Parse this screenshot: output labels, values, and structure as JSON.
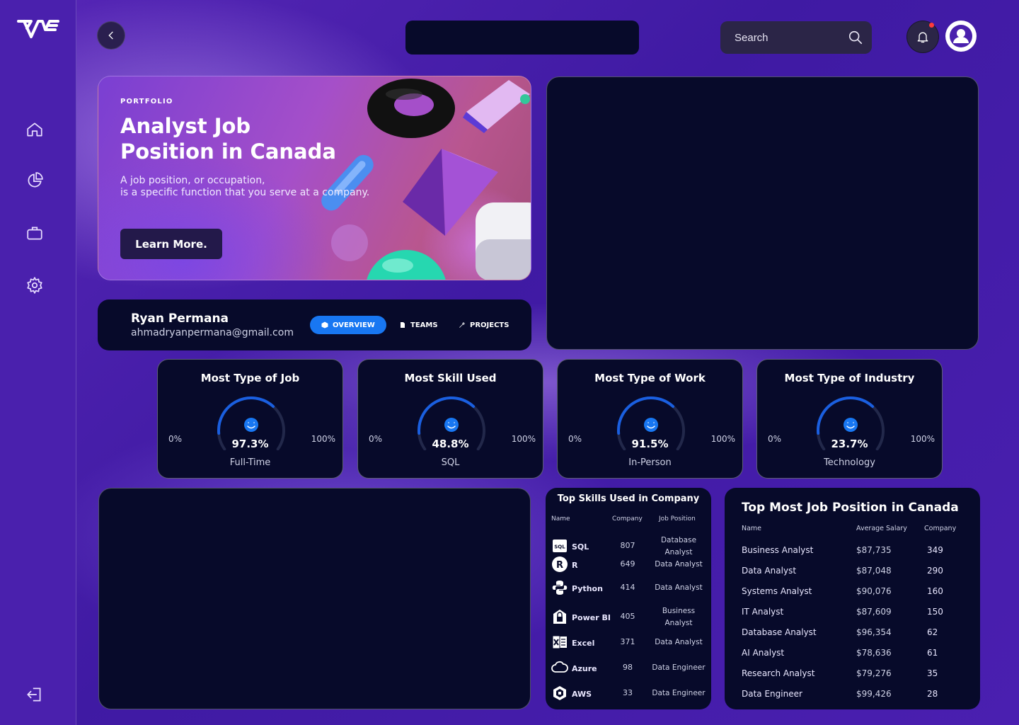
{
  "search": {
    "placeholder": "Search"
  },
  "hero": {
    "tag": "PORTFOLIO",
    "title": "Analyst Job Position in Canada",
    "desc_line1": "A job position, or occupation,",
    "desc_line2": "is a specific function that you serve at a company.",
    "button": "Learn More."
  },
  "profile": {
    "name": "Ryan Permana",
    "email": "ahmadryanpermana@gmail.com",
    "tabs": [
      {
        "label": "OVERVIEW",
        "icon": "cube-icon",
        "active": true
      },
      {
        "label": "TEAMS",
        "icon": "document-icon",
        "active": false
      },
      {
        "label": "PROJECTS",
        "icon": "wrench-icon",
        "active": false
      }
    ]
  },
  "gauges": [
    {
      "title": "Most Type of Job",
      "min": "0%",
      "max": "100%",
      "value_text": "97.3%",
      "value": 97.3,
      "label": "Full-Time"
    },
    {
      "title": "Most Skill Used",
      "min": "0%",
      "max": "100%",
      "value_text": "48.8%",
      "value": 48.8,
      "label": "SQL"
    },
    {
      "title": "Most Type of Work",
      "min": "0%",
      "max": "100%",
      "value_text": "91.5%",
      "value": 91.5,
      "label": "In-Person"
    },
    {
      "title": "Most Type of Industry",
      "min": "0%",
      "max": "100%",
      "value_text": "23.7%",
      "value": 23.7,
      "label": "Technology"
    }
  ],
  "skills": {
    "title": "Top Skills Used in Company",
    "headers": [
      "Name",
      "Company",
      "Job Position"
    ],
    "rows": [
      {
        "name": "SQL",
        "icon": "sql-icon",
        "count": "807",
        "job_line1": "Database",
        "job_line2": "Analyst"
      },
      {
        "name": "R",
        "icon": "r-icon",
        "count": "649",
        "job_line1": "Data Analyst",
        "job_line2": ""
      },
      {
        "name": "Python",
        "icon": "python-icon",
        "count": "414",
        "job_line1": "Data Analyst",
        "job_line2": ""
      },
      {
        "name": "Power BI",
        "icon": "powerbi-icon",
        "count": "405",
        "job_line1": "Business",
        "job_line2": "Analyst"
      },
      {
        "name": "Excel",
        "icon": "excel-icon",
        "count": "371",
        "job_line1": "Data Analyst",
        "job_line2": ""
      },
      {
        "name": "Azure",
        "icon": "azure-icon",
        "count": "98",
        "job_line1": "Data Engineer",
        "job_line2": ""
      },
      {
        "name": "AWS",
        "icon": "aws-icon",
        "count": "33",
        "job_line1": "Data Engineer",
        "job_line2": ""
      }
    ]
  },
  "jobs": {
    "title": "Top Most Job Position in Canada",
    "headers": [
      "Name",
      "Average Salary",
      "Company"
    ],
    "rows": [
      {
        "name": "Business Analyst",
        "salary": "$87,735",
        "company": "349"
      },
      {
        "name": "Data Analyst",
        "salary": "$87,048",
        "company": "290"
      },
      {
        "name": "Systems Analyst",
        "salary": "$90,076",
        "company": "160"
      },
      {
        "name": "IT Analyst",
        "salary": "$87,609",
        "company": "150"
      },
      {
        "name": "Database Analyst",
        "salary": "$96,354",
        "company": "62"
      },
      {
        "name": "AI Analyst",
        "salary": "$78,636",
        "company": "61"
      },
      {
        "name": "Research Analyst",
        "salary": "$79,276",
        "company": "35"
      },
      {
        "name": "Data Engineer",
        "salary": "$99,426",
        "company": "28"
      }
    ]
  },
  "colors": {
    "accent": "#1877f2",
    "panel": "#070a2a",
    "sidebar": "#4a20ad"
  }
}
